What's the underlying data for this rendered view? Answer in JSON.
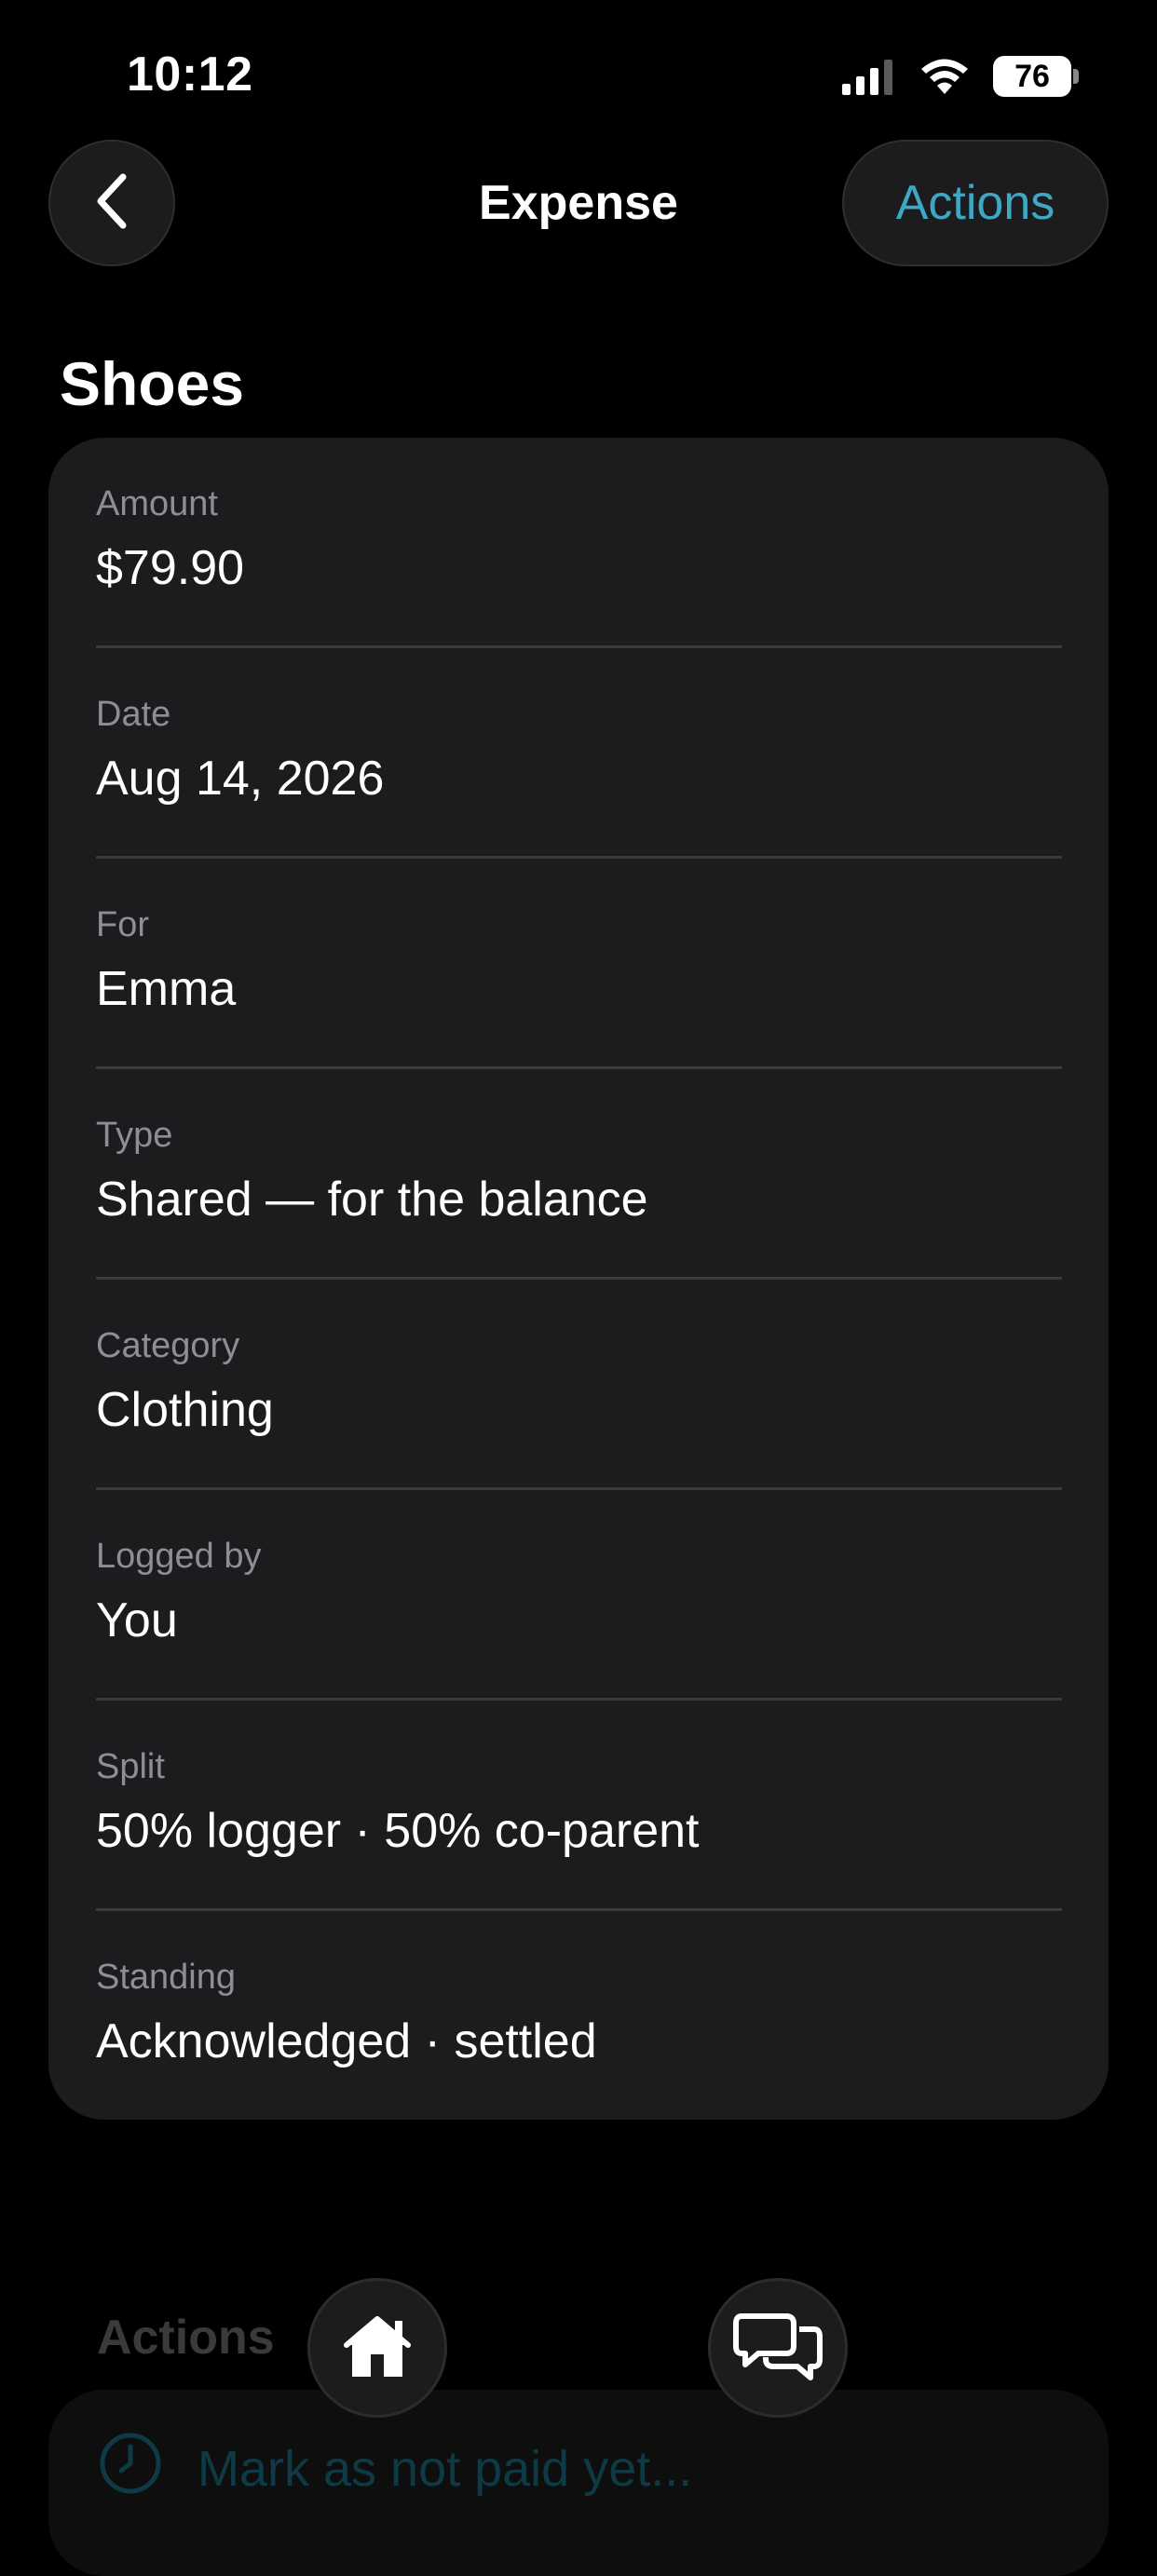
{
  "status_bar": {
    "time": "10:12",
    "battery": "76",
    "icons": [
      "signal-icon",
      "wifi-icon",
      "battery-icon"
    ]
  },
  "header": {
    "title": "Expense",
    "back_icon": "chevron-left-icon",
    "actions_label": "Actions"
  },
  "expense": {
    "title": "Shoes",
    "details": [
      {
        "label": "Amount",
        "value": "$79.90"
      },
      {
        "label": "Date",
        "value": "Aug 14, 2026"
      },
      {
        "label": "For",
        "value": "Emma"
      },
      {
        "label": "Type",
        "value": "Shared — for the balance"
      },
      {
        "label": "Category",
        "value": "Clothing"
      },
      {
        "label": "Logged by",
        "value": "You"
      },
      {
        "label": "Split",
        "value": "50% logger · 50% co-parent"
      },
      {
        "label": "Standing",
        "value": "Acknowledged · settled"
      }
    ]
  },
  "actions_section": {
    "heading": "Actions",
    "items": [
      {
        "label": "Mark as not paid yet...",
        "icon": "clock-icon"
      }
    ]
  },
  "tab_bar": {
    "icons": [
      "home-icon",
      "messages-icon"
    ]
  },
  "colors": {
    "background": "#000000",
    "card": "#1c1c1e",
    "accent": "#3ea7c4",
    "label": "#8e8e93",
    "divider": "#3a3a3c"
  }
}
